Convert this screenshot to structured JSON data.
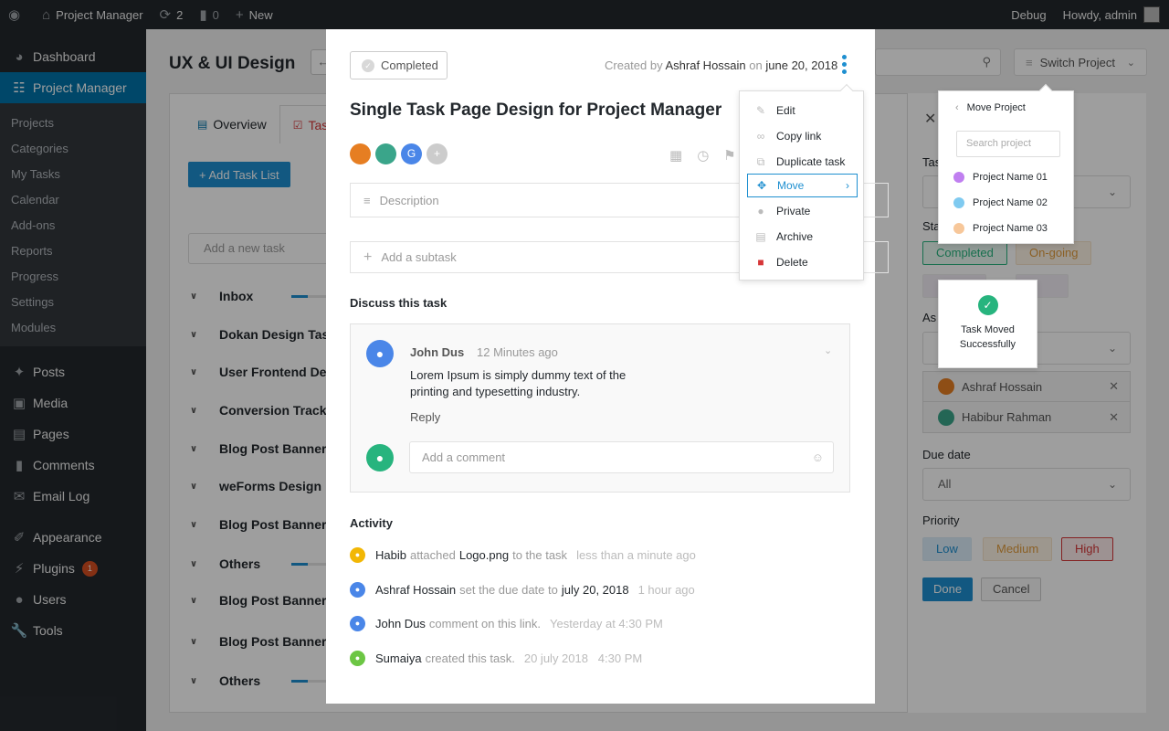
{
  "adminbar": {
    "site_name": "Project Manager",
    "updates_count": "2",
    "comments_count": "0",
    "new_label": "New",
    "debug_label": "Debug",
    "howdy_label": "Howdy, admin"
  },
  "sidebar": {
    "dashboard": "Dashboard",
    "project_manager": "Project Manager",
    "submenu": [
      "Projects",
      "Categories",
      "My Tasks",
      "Calendar",
      "Add-ons",
      "Reports",
      "Progress",
      "Settings",
      "Modules"
    ],
    "posts": "Posts",
    "media": "Media",
    "pages": "Pages",
    "comments": "Comments",
    "email_log": "Email Log",
    "appearance": "Appearance",
    "plugins": "Plugins",
    "plugins_badge": "1",
    "users": "Users",
    "tools": "Tools"
  },
  "page": {
    "title": "UX & UI Design",
    "switch_project": "Switch Project",
    "tabs": [
      "Overview",
      "Tasks"
    ],
    "add_task_list": "+ Add Task List",
    "new_task_placeholder": "Add a new task",
    "task_lists": [
      {
        "name": "Inbox",
        "progress": 0.45
      },
      {
        "name": "Dokan Design Tasks",
        "progress": null
      },
      {
        "name": "User Frontend Design",
        "progress": null
      },
      {
        "name": "Conversion Tracking",
        "progress": null
      },
      {
        "name": "Blog Post Banner",
        "progress": null
      },
      {
        "name": "weForms Design",
        "progress": null
      },
      {
        "name": "Blog Post Banner",
        "progress": null
      },
      {
        "name": "Others",
        "progress": 0.45
      },
      {
        "name": "Blog Post Banner",
        "progress": null
      },
      {
        "name": "Blog Post Banner",
        "progress": null
      },
      {
        "name": "Others",
        "progress": 0.45
      }
    ]
  },
  "filter": {
    "task_label": "Tas",
    "status_label": "Sta",
    "assignee_label": "As",
    "status_completed": "Completed",
    "status_ongoing": "On-going",
    "assignees": [
      "Ashraf Hossain",
      "Habibur Rahman"
    ],
    "due_date_label": "Due date",
    "due_date_value": "All",
    "priority_label": "Priority",
    "priorities": [
      "Low",
      "Medium",
      "High"
    ],
    "done_label": "Done",
    "cancel_label": "Cancel"
  },
  "modal": {
    "status_button": "Completed",
    "created_by_prefix": "Created by",
    "created_by_name": "Ashraf Hossain",
    "created_on_prefix": "on",
    "created_on_date": "june 20, 2018",
    "title": "Single Task Page Design for Project Manager",
    "description_placeholder": "Description",
    "subtask_placeholder": "Add a subtask",
    "discuss_heading": "Discuss this task",
    "comment": {
      "author": "John Dus",
      "time": "12 Minutes ago",
      "text": "Lorem Ipsum is simply dummy text of the printing and typesetting industry.",
      "reply": "Reply"
    },
    "comment_placeholder": "Add a comment",
    "activity_heading": "Activity",
    "activity": [
      {
        "who": "Habib",
        "what": "attached",
        "obj": "Logo.png",
        "rest": "to the task",
        "when": "less than a minute ago",
        "color": "#f2b705"
      },
      {
        "who": "Ashraf Hossain",
        "what": "set the due date to",
        "obj": "july 20, 2018",
        "rest": "",
        "when": "1 hour ago",
        "color": "#4a86e8"
      },
      {
        "who": "John Dus",
        "what": "comment on this link.",
        "obj": "",
        "rest": "",
        "when": "Yesterday at 4:30 PM",
        "color": "#4a86e8"
      },
      {
        "who": "Sumaiya",
        "what": "created this task.",
        "obj": "",
        "rest": "",
        "when": "20 july 2018   4:30 PM",
        "color": "#6cc644"
      }
    ]
  },
  "menu": {
    "items": [
      "Edit",
      "Copy link",
      "Duplicate task",
      "Move",
      "Private",
      "Archive",
      "Delete"
    ]
  },
  "move_popover": {
    "title": "Move Project",
    "search_placeholder": "Search project",
    "projects": [
      {
        "name": "Project Name 01",
        "color": "#c07ff0"
      },
      {
        "name": "Project Name 02",
        "color": "#7fcaf0"
      },
      {
        "name": "Project Name 03",
        "color": "#f7c79a"
      }
    ]
  },
  "toast": {
    "message": "Task Moved Successfully"
  },
  "colors": {
    "accent": "#1e8fd0",
    "wp_blue": "#0073aa",
    "success": "#27b47e",
    "danger": "#d63638"
  }
}
